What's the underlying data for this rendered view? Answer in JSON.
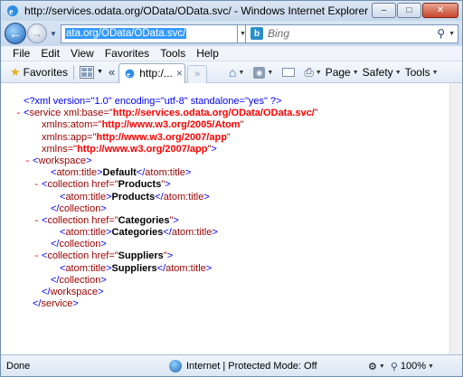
{
  "window": {
    "title": "http://services.odata.org/OData/OData.svc/ - Windows Internet Explorer"
  },
  "address": {
    "url": "ata.org/OData/OData.svc/",
    "back_icon": "back-arrow-icon",
    "forward_icon": "forward-arrow-icon"
  },
  "search": {
    "provider": "Bing",
    "placeholder": "Bing"
  },
  "menu": {
    "items": [
      "File",
      "Edit",
      "View",
      "Favorites",
      "Tools",
      "Help"
    ]
  },
  "command_bar": {
    "favorites_label": "Favorites",
    "tab_label": "http:/...",
    "page_label": "Page",
    "safety_label": "Safety",
    "tools_label": "Tools",
    "scroll_left": "«",
    "tab_close": "×",
    "new_tab": "»"
  },
  "document": {
    "lines": [
      {
        "indent": 0,
        "minus": "",
        "parts": [
          {
            "c": "pi",
            "t": "<?xml version=\"1.0\" encoding=\"utf-8\" standalone=\"yes\" ?>"
          }
        ]
      },
      {
        "indent": 0,
        "minus": "-",
        "parts": [
          {
            "c": "bracket",
            "t": "<"
          },
          {
            "c": "tag",
            "t": "service "
          },
          {
            "c": "attr",
            "t": "xml:base=\""
          },
          {
            "c": "attrval",
            "t": "http://services.odata.org/OData/OData.svc/"
          },
          {
            "c": "attr",
            "t": "\""
          }
        ]
      },
      {
        "indent": 2,
        "minus": "",
        "parts": [
          {
            "c": "attr",
            "t": "xmlns:atom=\""
          },
          {
            "c": "attrval",
            "t": "http://www.w3.org/2005/Atom"
          },
          {
            "c": "attr",
            "t": "\""
          }
        ]
      },
      {
        "indent": 2,
        "minus": "",
        "parts": [
          {
            "c": "attr",
            "t": "xmlns:app=\""
          },
          {
            "c": "attrval",
            "t": "http://www.w3.org/2007/app"
          },
          {
            "c": "attr",
            "t": "\""
          }
        ]
      },
      {
        "indent": 2,
        "minus": "",
        "parts": [
          {
            "c": "attr",
            "t": "xmlns=\""
          },
          {
            "c": "attrval",
            "t": "http://www.w3.org/2007/app"
          },
          {
            "c": "attr",
            "t": "\""
          },
          {
            "c": "bracket",
            "t": ">"
          }
        ]
      },
      {
        "indent": 1,
        "minus": "-",
        "parts": [
          {
            "c": "bracket",
            "t": "<"
          },
          {
            "c": "tag",
            "t": "workspace"
          },
          {
            "c": "bracket",
            "t": ">"
          }
        ]
      },
      {
        "indent": 3,
        "minus": "",
        "parts": [
          {
            "c": "bracket",
            "t": "<"
          },
          {
            "c": "tag",
            "t": "atom:title"
          },
          {
            "c": "bracket",
            "t": ">"
          },
          {
            "c": "txt",
            "t": "Default"
          },
          {
            "c": "bracket",
            "t": "</"
          },
          {
            "c": "tag",
            "t": "atom:title"
          },
          {
            "c": "bracket",
            "t": ">"
          }
        ]
      },
      {
        "indent": 2,
        "minus": "-",
        "parts": [
          {
            "c": "bracket",
            "t": "<"
          },
          {
            "c": "tag",
            "t": "collection "
          },
          {
            "c": "attr",
            "t": "href=\""
          },
          {
            "c": "txt",
            "t": "Products"
          },
          {
            "c": "attr",
            "t": "\""
          },
          {
            "c": "bracket",
            "t": ">"
          }
        ]
      },
      {
        "indent": 4,
        "minus": "",
        "parts": [
          {
            "c": "bracket",
            "t": "<"
          },
          {
            "c": "tag",
            "t": "atom:title"
          },
          {
            "c": "bracket",
            "t": ">"
          },
          {
            "c": "txt",
            "t": "Products"
          },
          {
            "c": "bracket",
            "t": "</"
          },
          {
            "c": "tag",
            "t": "atom:title"
          },
          {
            "c": "bracket",
            "t": ">"
          }
        ]
      },
      {
        "indent": 3,
        "minus": "",
        "parts": [
          {
            "c": "bracket",
            "t": "</"
          },
          {
            "c": "tag",
            "t": "collection"
          },
          {
            "c": "bracket",
            "t": ">"
          }
        ]
      },
      {
        "indent": 2,
        "minus": "-",
        "parts": [
          {
            "c": "bracket",
            "t": "<"
          },
          {
            "c": "tag",
            "t": "collection "
          },
          {
            "c": "attr",
            "t": "href=\""
          },
          {
            "c": "txt",
            "t": "Categories"
          },
          {
            "c": "attr",
            "t": "\""
          },
          {
            "c": "bracket",
            "t": ">"
          }
        ]
      },
      {
        "indent": 4,
        "minus": "",
        "parts": [
          {
            "c": "bracket",
            "t": "<"
          },
          {
            "c": "tag",
            "t": "atom:title"
          },
          {
            "c": "bracket",
            "t": ">"
          },
          {
            "c": "txt",
            "t": "Categories"
          },
          {
            "c": "bracket",
            "t": "</"
          },
          {
            "c": "tag",
            "t": "atom:title"
          },
          {
            "c": "bracket",
            "t": ">"
          }
        ]
      },
      {
        "indent": 3,
        "minus": "",
        "parts": [
          {
            "c": "bracket",
            "t": "</"
          },
          {
            "c": "tag",
            "t": "collection"
          },
          {
            "c": "bracket",
            "t": ">"
          }
        ]
      },
      {
        "indent": 2,
        "minus": "-",
        "parts": [
          {
            "c": "bracket",
            "t": "<"
          },
          {
            "c": "tag",
            "t": "collection "
          },
          {
            "c": "attr",
            "t": "href=\""
          },
          {
            "c": "txt",
            "t": "Suppliers"
          },
          {
            "c": "attr",
            "t": "\""
          },
          {
            "c": "bracket",
            "t": ">"
          }
        ]
      },
      {
        "indent": 4,
        "minus": "",
        "parts": [
          {
            "c": "bracket",
            "t": "<"
          },
          {
            "c": "tag",
            "t": "atom:title"
          },
          {
            "c": "bracket",
            "t": ">"
          },
          {
            "c": "txt",
            "t": "Suppliers"
          },
          {
            "c": "bracket",
            "t": "</"
          },
          {
            "c": "tag",
            "t": "atom:title"
          },
          {
            "c": "bracket",
            "t": ">"
          }
        ]
      },
      {
        "indent": 3,
        "minus": "",
        "parts": [
          {
            "c": "bracket",
            "t": "</"
          },
          {
            "c": "tag",
            "t": "collection"
          },
          {
            "c": "bracket",
            "t": ">"
          }
        ]
      },
      {
        "indent": 2,
        "minus": "",
        "parts": [
          {
            "c": "bracket",
            "t": "</"
          },
          {
            "c": "tag",
            "t": "workspace"
          },
          {
            "c": "bracket",
            "t": ">"
          }
        ]
      },
      {
        "indent": 1,
        "minus": "",
        "parts": [
          {
            "c": "bracket",
            "t": "</"
          },
          {
            "c": "tag",
            "t": "service"
          },
          {
            "c": "bracket",
            "t": ">"
          }
        ]
      }
    ]
  },
  "status": {
    "text": "Done",
    "zone": "Internet | Protected Mode: Off",
    "zoom": "100%"
  },
  "colors": {
    "pi": "#0000ff",
    "tag": "#990000",
    "attr_value": "#ff0000",
    "minus": "#ff0000"
  }
}
